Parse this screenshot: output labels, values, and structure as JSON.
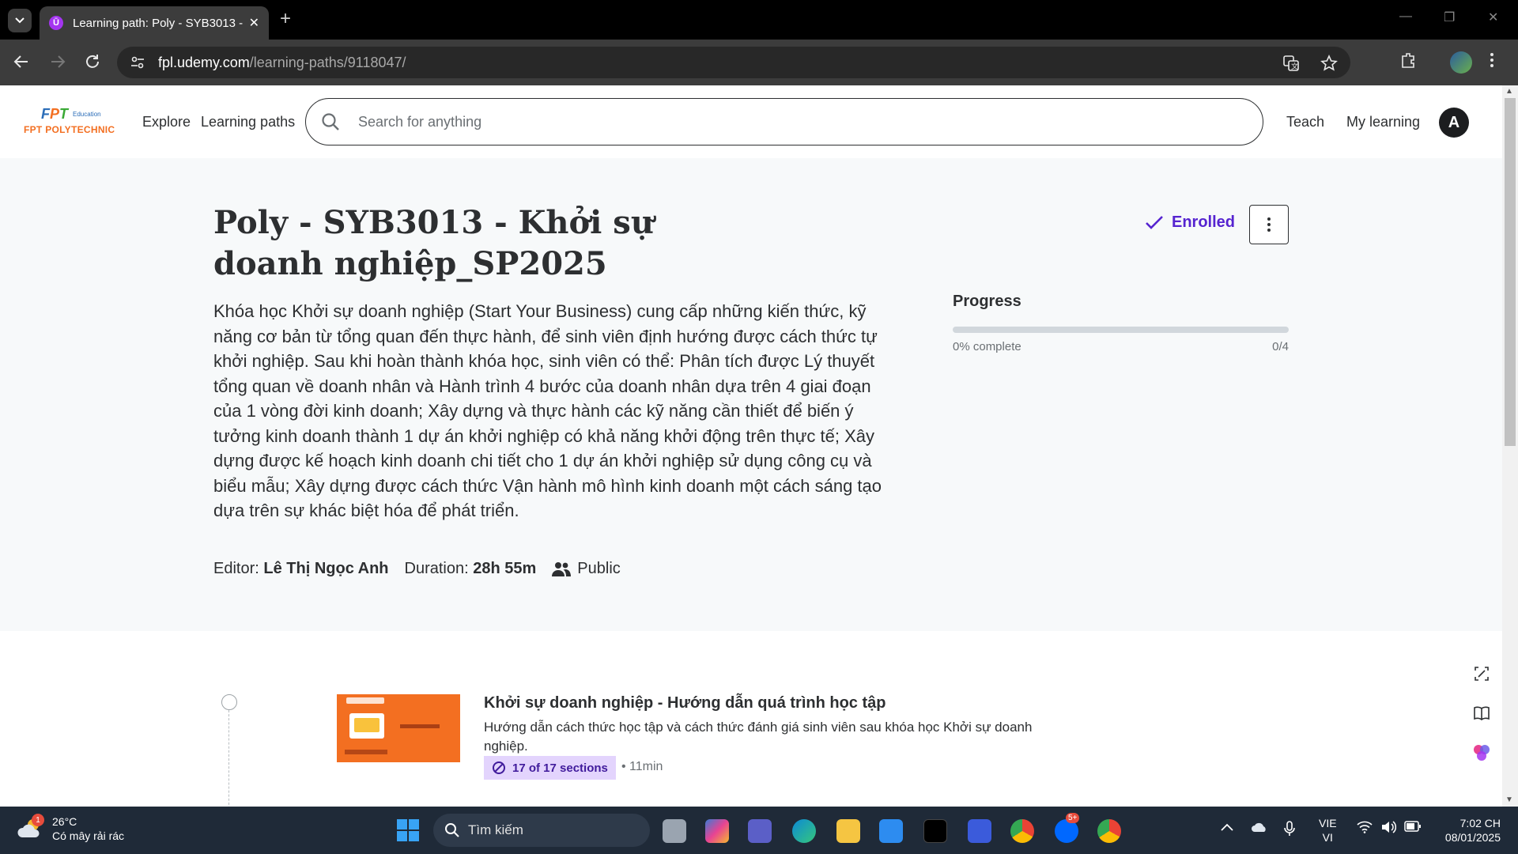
{
  "browser": {
    "tab_title": "Learning path: Poly - SYB3013 - ",
    "url_domain": "fpl.udemy.com",
    "url_path": "/learning-paths/9118047/"
  },
  "header": {
    "logo_brand": "FPT",
    "logo_edu": "Education",
    "logo_name": "FPT POLYTECHNIC",
    "explore": "Explore",
    "learning_paths": "Learning paths",
    "search_placeholder": "Search for anything",
    "teach": "Teach",
    "my_learning": "My learning",
    "avatar_initial": "A"
  },
  "path": {
    "title": "Poly - SYB3013 - Khởi sự doanh nghiệp_SP2025",
    "description": "Khóa học Khởi sự doanh nghiệp (Start Your Business) cung cấp những kiến thức, kỹ năng cơ bản từ tổng quan đến thực hành, để sinh viên định hướng được cách thức tự khởi nghiệp. Sau khi hoàn thành khóa học, sinh viên có thể: Phân tích được Lý thuyết tổng quan về doanh nhân và Hành trình 4 bước của doanh nhân dựa trên 4 giai đoạn của 1 vòng đời kinh doanh; Xây dựng và thực hành các kỹ năng cần thiết để biến ý tưởng kinh doanh thành 1 dự án khởi nghiệp có khả năng khởi động trên thực tế; Xây dựng được kế hoạch kinh doanh chi tiết cho 1 dự án khởi nghiệp sử dụng công cụ và biểu mẫu; Xây dựng được cách thức Vận hành mô hình kinh doanh một cách sáng tạo dựa trên sự khác biệt hóa để phát triển.",
    "editor_label": "Editor:",
    "editor_name": "Lê Thị Ngọc Anh",
    "duration_label": "Duration:",
    "duration_value": "28h 55m",
    "visibility": "Public",
    "enrolled_label": "Enrolled",
    "progress_label": "Progress",
    "progress_percent": 0,
    "progress_text": "0% complete",
    "progress_count": "0/4"
  },
  "courses": [
    {
      "title": "Khởi sự doanh nghiệp - Hướng dẫn quá trình học tập",
      "description": "Hướng dẫn cách thức học tập và cách thức đánh giá sinh viên sau khóa học Khởi sự doanh nghiệp.",
      "sections": "17 of 17 sections",
      "duration": "• 11min"
    }
  ],
  "taskbar": {
    "temperature": "26°C",
    "weather": "Có mây rải rác",
    "weather_badge": "1",
    "search_label": "Tìm kiếm",
    "zalo_badge": "5+",
    "lang_top": "VIE",
    "lang_bottom": "VI",
    "time": "7:02 CH",
    "date": "08/01/2025"
  },
  "colors": {
    "accent": "#5624d0",
    "badge_bg": "#e3d4fd",
    "brand_orange": "#f36f21"
  }
}
